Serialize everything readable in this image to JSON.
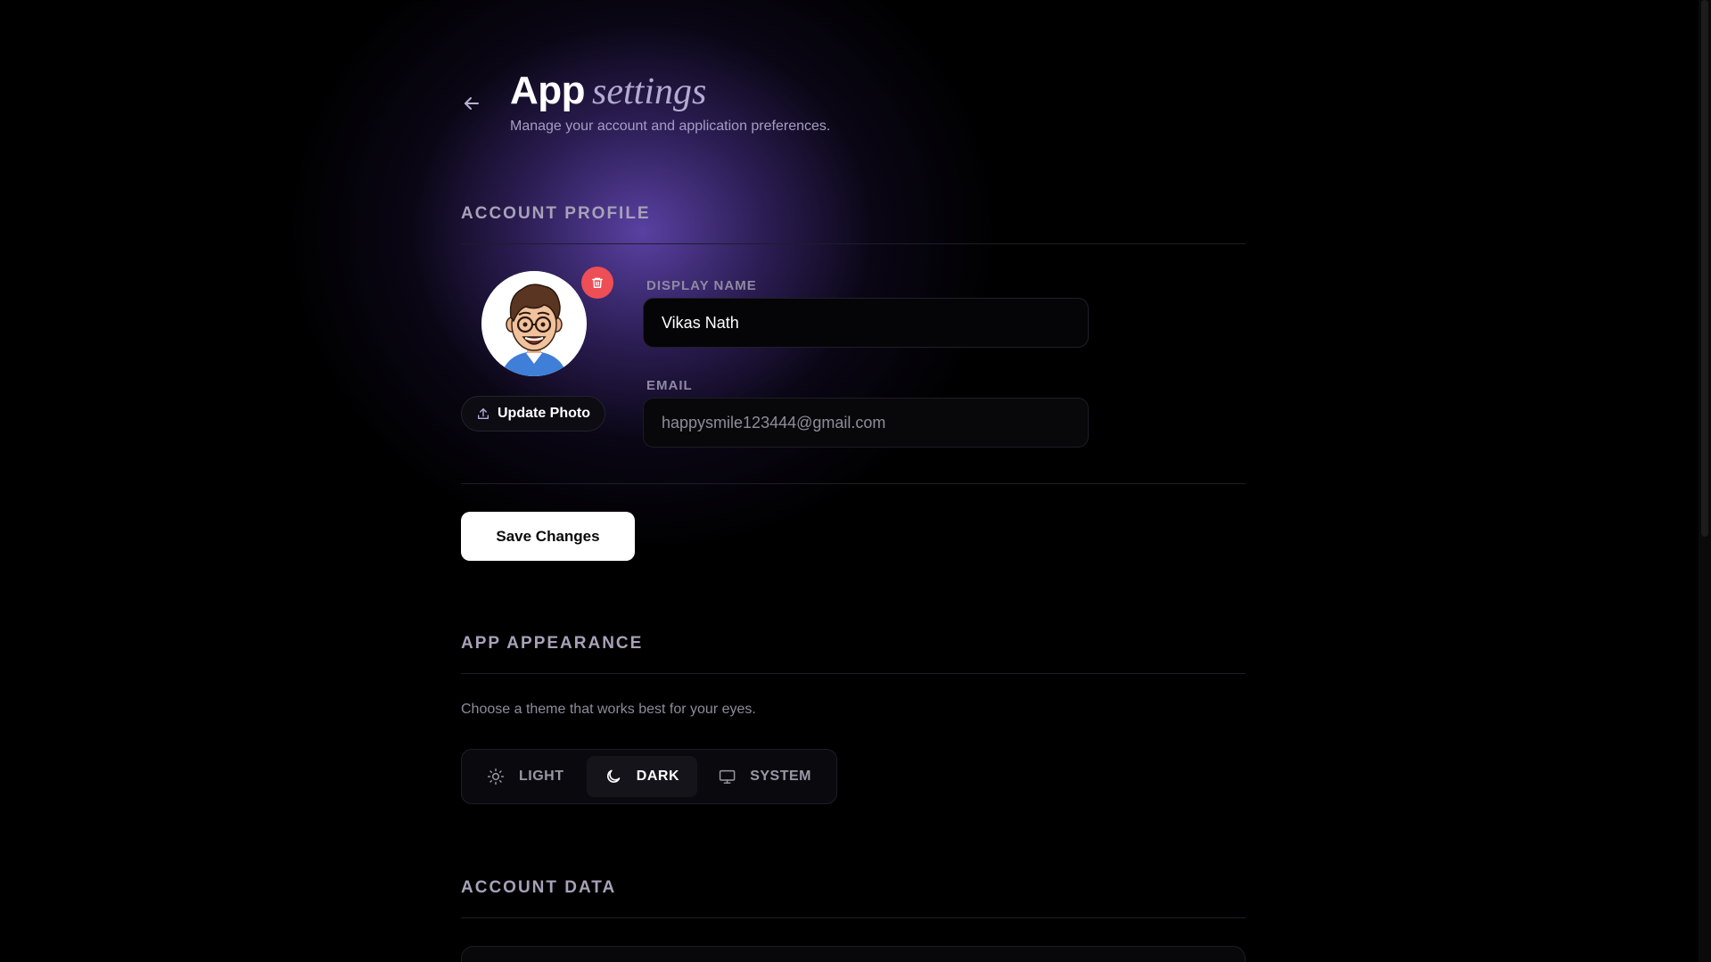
{
  "header": {
    "title_main": "App",
    "title_script": "settings",
    "subtitle": "Manage your account and application preferences."
  },
  "account_profile": {
    "section_title": "ACCOUNT PROFILE",
    "update_photo_label": "Update Photo",
    "display_name_label": "DISPLAY NAME",
    "display_name_value": "Vikas Nath",
    "email_label": "EMAIL",
    "email_value": "happysmile123444@gmail.com",
    "save_label": "Save Changes"
  },
  "appearance": {
    "section_title": "APP APPEARANCE",
    "description": "Choose a theme that works best for your eyes.",
    "options": [
      {
        "label": "LIGHT",
        "icon": "sun-icon"
      },
      {
        "label": "DARK",
        "icon": "moon-icon"
      },
      {
        "label": "SYSTEM",
        "icon": "monitor-icon"
      }
    ],
    "selected": "DARK"
  },
  "account_data": {
    "section_title": "ACCOUNT DATA"
  },
  "colors": {
    "background": "#000000",
    "glow": "#6a4fc4",
    "delete_badge": "#ee4e55",
    "primary_button": "#ffffff"
  }
}
